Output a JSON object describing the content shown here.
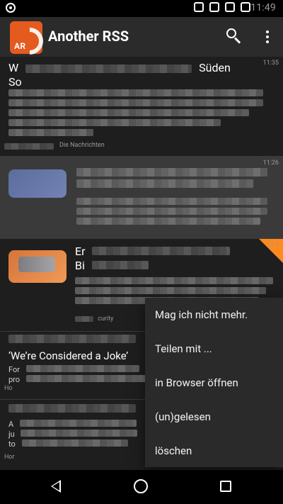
{
  "status": {
    "time": "11:49"
  },
  "app": {
    "title": "Another RSS",
    "logo_text": "AR"
  },
  "feed": {
    "item1": {
      "title_start": "W",
      "title_end": "Süden",
      "title_line2": "So",
      "time": "11:35",
      "source": "Die Nachrichten"
    },
    "item2": {
      "time": "11:26"
    },
    "item3": {
      "title_start": "Er",
      "title_line2": "Bi",
      "time": "11:1",
      "source_suffix": "curity"
    },
    "item4": {
      "title": "‘We’re Considered a Joke’",
      "desc_prefix": "For",
      "desc_prefix2": "pro",
      "source_prefix": "Ho"
    },
    "item5": {
      "desc_prefix": "A",
      "desc_prefix2": "ju",
      "desc_prefix3": "to",
      "source_prefix": "Hor"
    }
  },
  "menu": {
    "items": [
      "Mag ich nicht mehr.",
      "Teilen mit ...",
      "in Browser öffnen",
      "(un)gelesen",
      "löschen"
    ]
  }
}
